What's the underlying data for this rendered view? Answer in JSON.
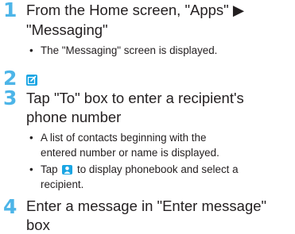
{
  "colors": {
    "accent": "#4db5e8",
    "icon": "#1aa5e3"
  },
  "steps": [
    {
      "number": "1",
      "title_lines": [
        "From the Home screen, \"Apps\" ▶",
        "\"Messaging\""
      ],
      "bullets": [
        {
          "lines": [
            "The \"Messaging\" screen is displayed."
          ]
        }
      ]
    },
    {
      "number": "2",
      "icon": "compose-icon"
    },
    {
      "number": "3",
      "title_lines": [
        "Tap \"To\" box to enter a recipient's",
        "phone number"
      ],
      "bullets": [
        {
          "lines": [
            "A list of contacts beginning with the",
            "entered number or name is displayed."
          ]
        },
        {
          "pre": "Tap ",
          "icon": "contact-icon",
          "post": " to display phonebook and select a",
          "cont": "recipient."
        }
      ]
    },
    {
      "number": "4",
      "title_lines": [
        "Enter a message in \"Enter message\"",
        "box"
      ]
    }
  ],
  "bullet_char": "•"
}
